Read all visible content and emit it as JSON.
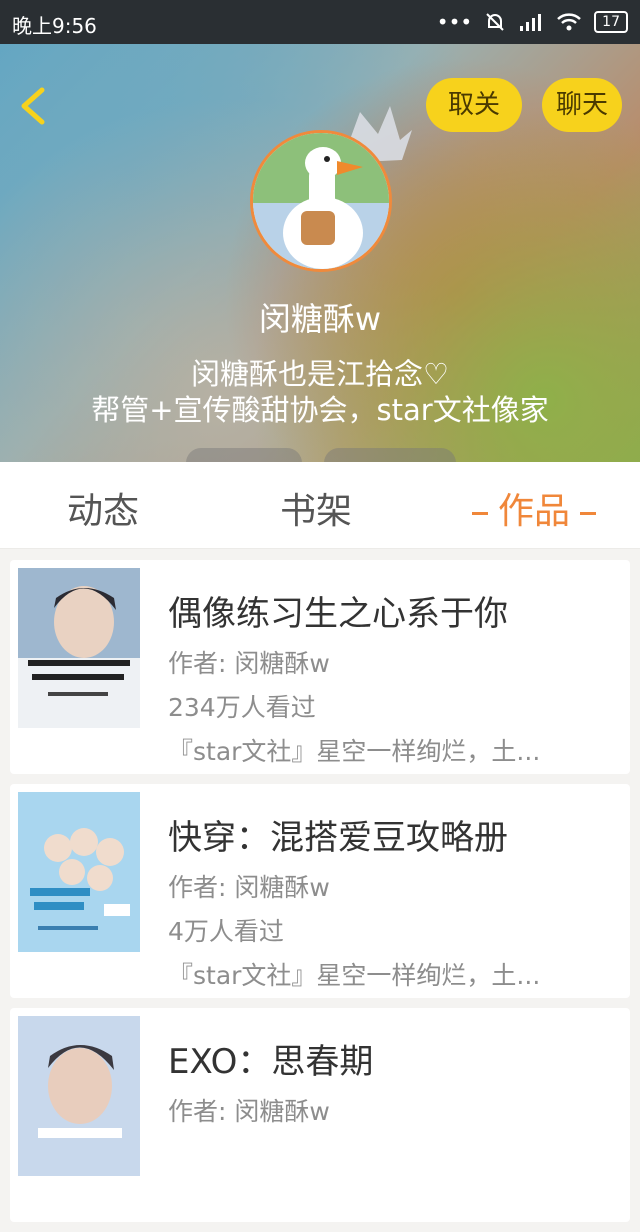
{
  "status_bar": {
    "time": "晚上9:56",
    "dots": "•••",
    "battery": "17"
  },
  "header": {
    "unfollow_label": "取关",
    "chat_label": "聊天",
    "username": "闵糖酥w",
    "bio_line1": "闵糖酥也是江拾念♡",
    "bio_line2": "帮管+宣传酸甜协会，star文社像家"
  },
  "tabs": {
    "dynamic": "动态",
    "shelf": "书架",
    "works": "作品"
  },
  "works": [
    {
      "title": "偶像练习生之心系于你",
      "author": "作者: 闵糖酥w",
      "views": "234万人看过",
      "desc": "『star文社』星空一样绚烂，土..."
    },
    {
      "title": "快穿：混搭爱豆攻略册",
      "author": "作者: 闵糖酥w",
      "views": "4万人看过",
      "desc": "『star文社』星空一样绚烂，土..."
    },
    {
      "title": "EXO：思春期",
      "author": "作者: 闵糖酥w",
      "views": "",
      "desc": ""
    }
  ],
  "colors": {
    "accent": "#f0873a",
    "button_yellow": "#f7d21c",
    "status_bar": "#2a2f33"
  }
}
